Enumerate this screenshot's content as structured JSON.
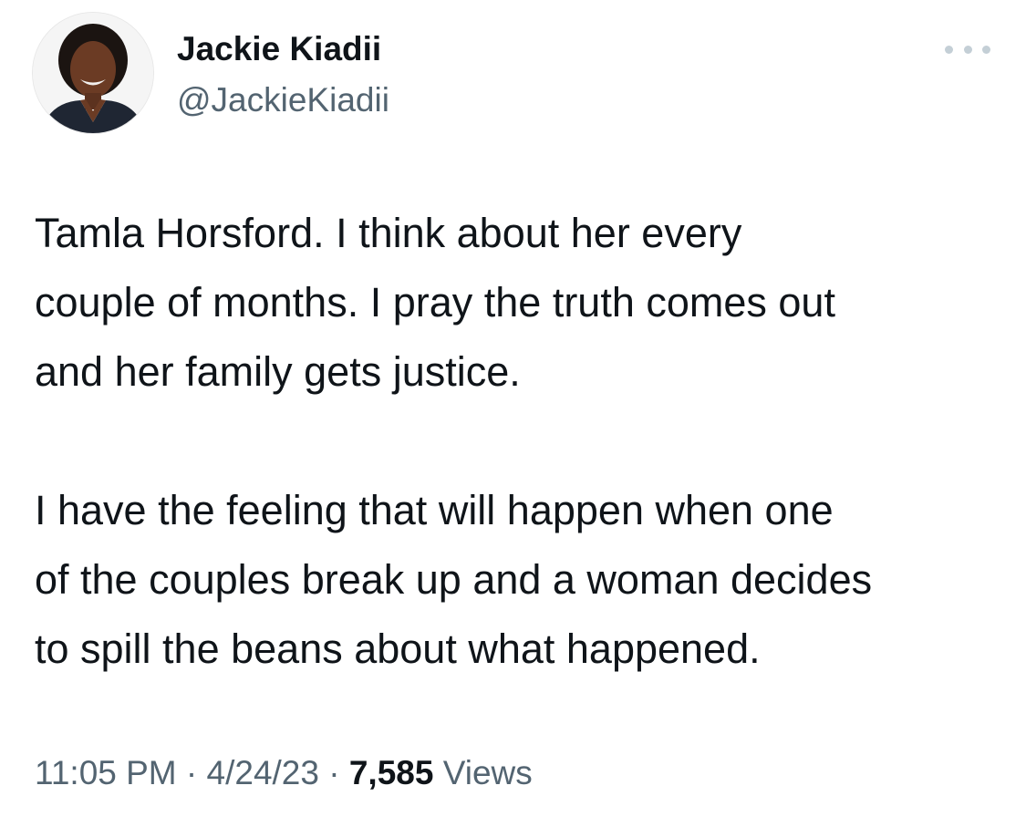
{
  "author": {
    "display_name": "Jackie Kiadii",
    "handle": "@JackieKiadii"
  },
  "menu_icon": "more-horizontal-icon",
  "tweet": {
    "paragraphs": [
      [
        "Tamla Horsford. I think about her every",
        "couple of months. I pray the truth comes out",
        "and her family gets justice."
      ],
      [
        "I have the feeling that will happen when one",
        "of the couples break up and a woman decides",
        "to spill the beans about what happened."
      ]
    ]
  },
  "meta": {
    "time": "11:05 PM",
    "separator": "·",
    "date": "4/24/23",
    "views_count": "7,585",
    "views_label": "Views"
  },
  "colors": {
    "text": "#0f1419",
    "secondary": "#536471",
    "dots": "#c4cfd6"
  }
}
